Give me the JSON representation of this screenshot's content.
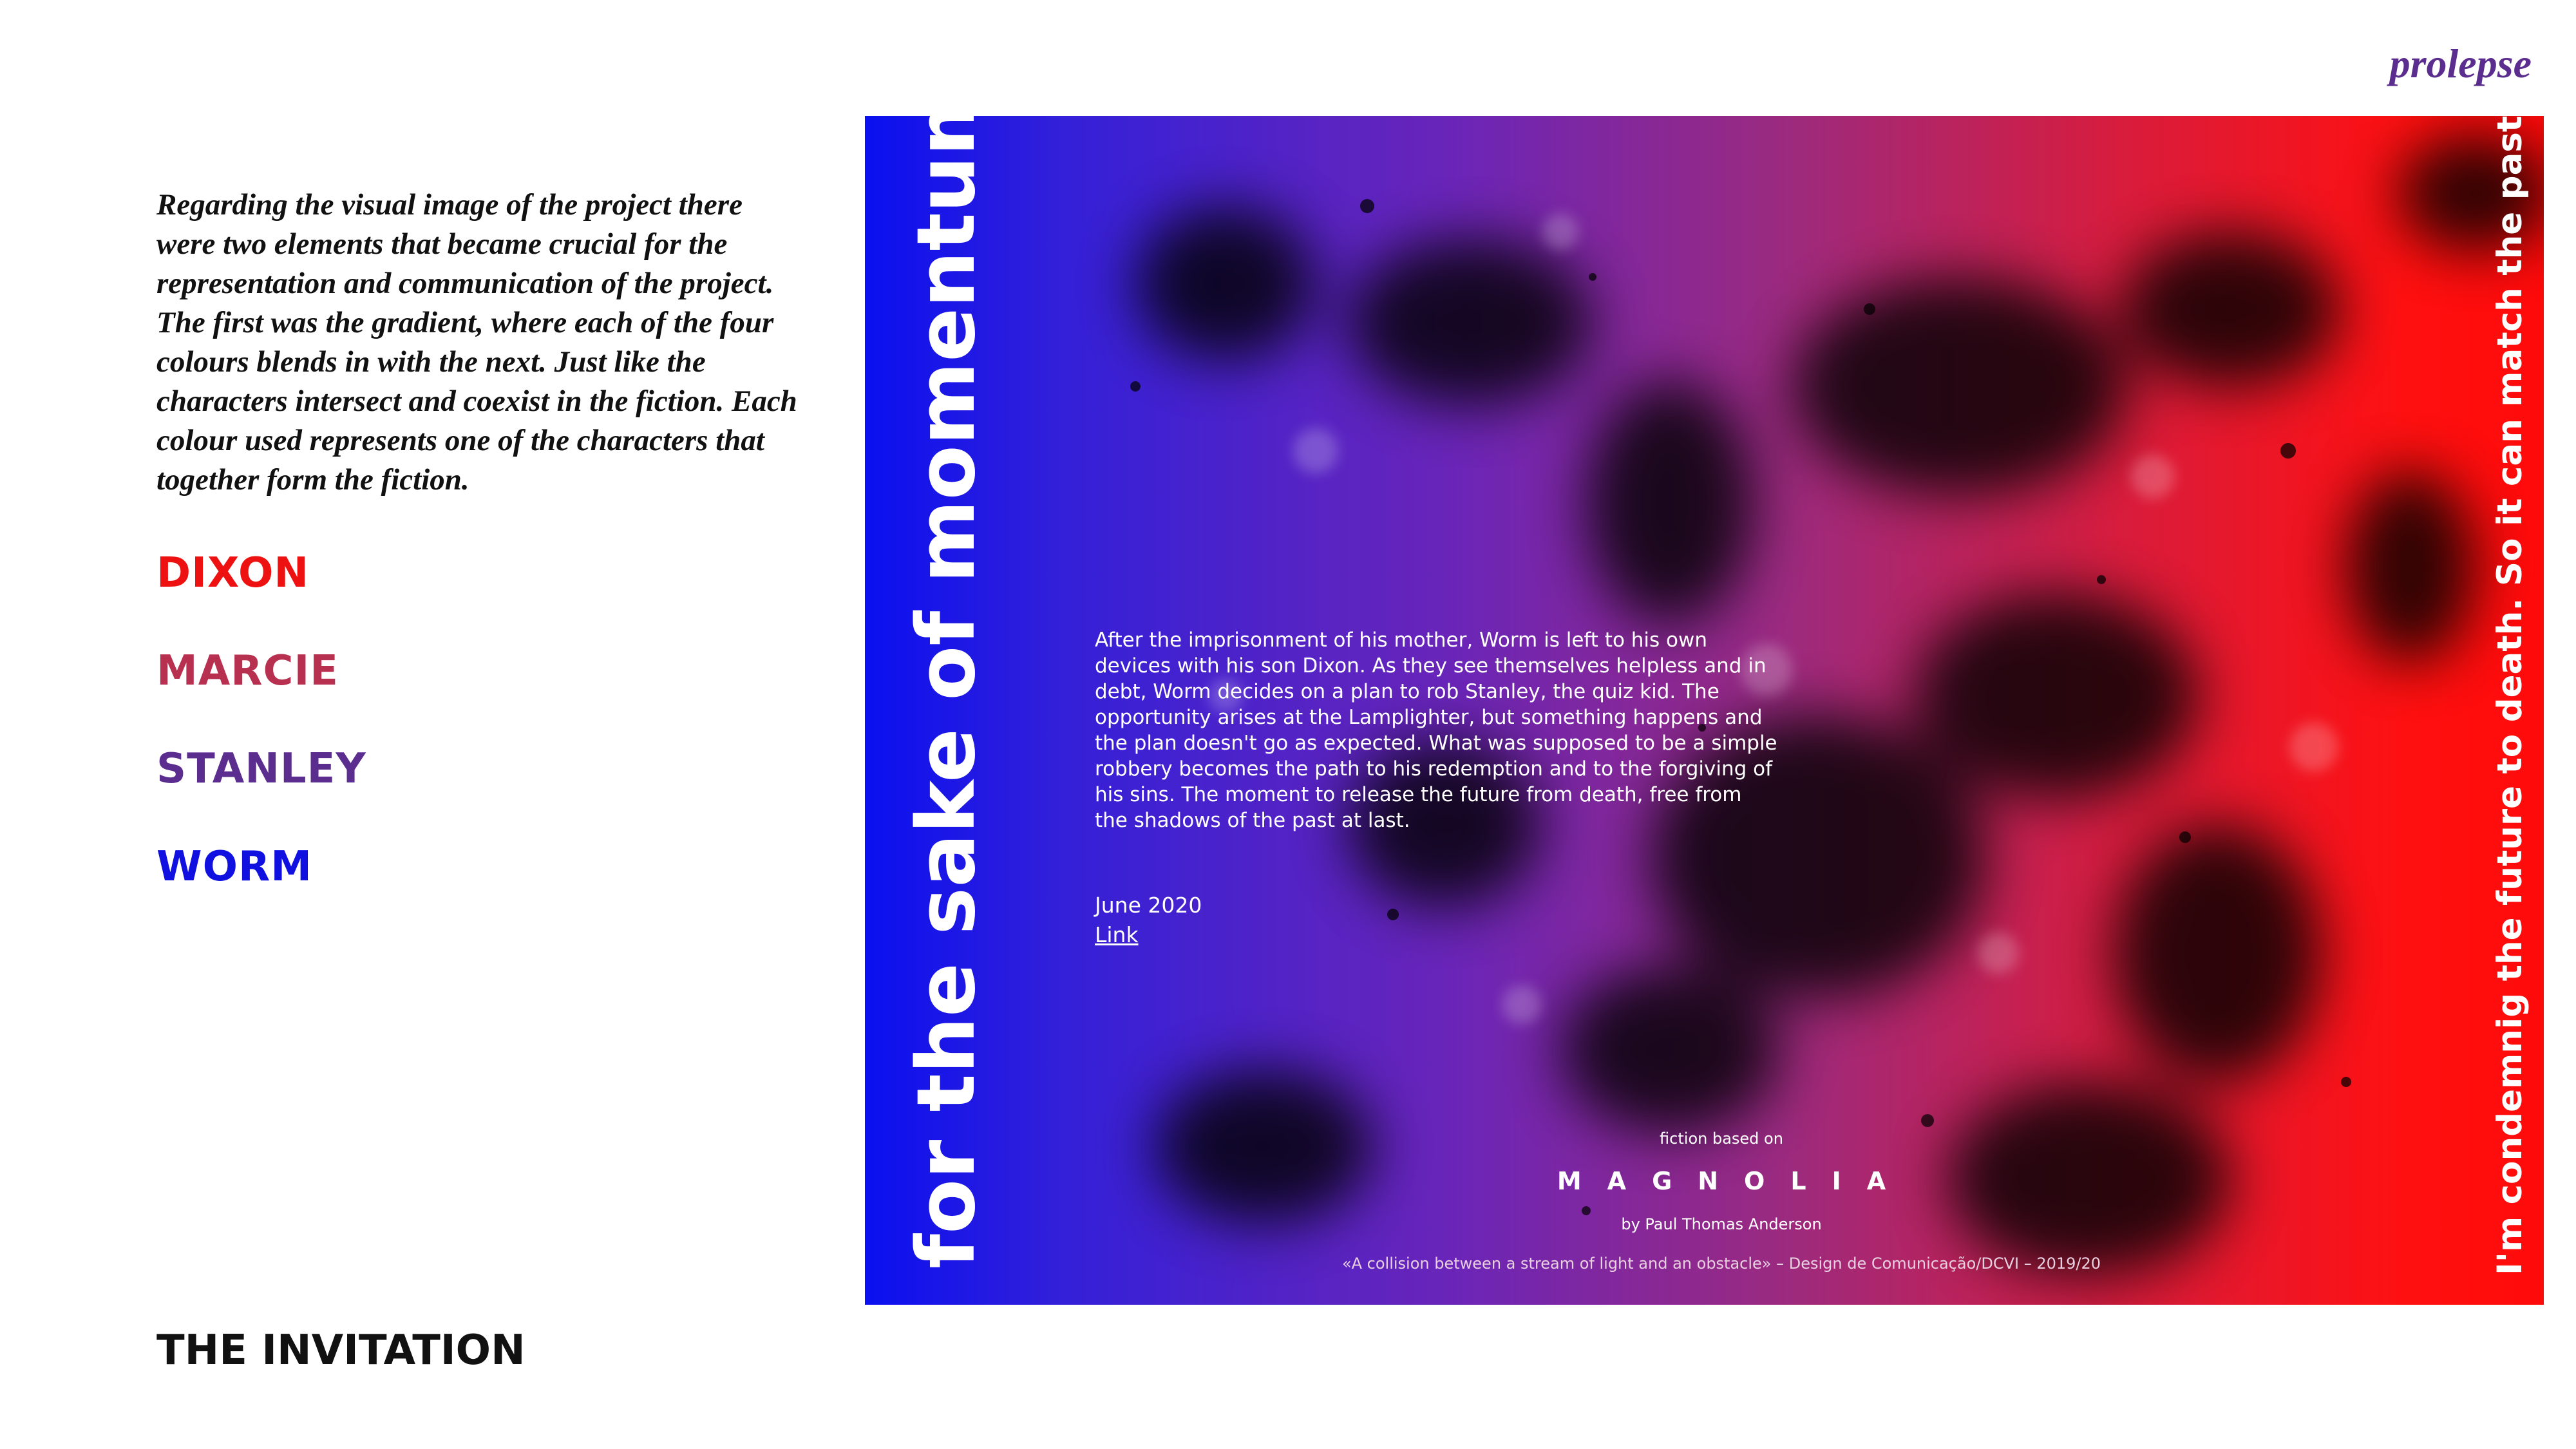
{
  "header": {
    "brand": "prolepse"
  },
  "intro": {
    "text": "Regarding the visual image of the project there were two elements that became crucial for the representation and communication of the project. The first was the gradient, where each of the four colours blends in with the next. Just like the characters intersect and coexist in the fiction. Each colour used represents one of the characters that together form the fiction."
  },
  "characters": [
    {
      "name": "DIXON",
      "color": "#ee1111"
    },
    {
      "name": "MARCIE",
      "color": "#b83050"
    },
    {
      "name": "STANLEY",
      "color": "#5b2d8e"
    },
    {
      "name": "WORM",
      "color": "#1010e0"
    }
  ],
  "section": {
    "title": "THE INVITATION"
  },
  "poster": {
    "vertical_left": "for the sake of momentum",
    "vertical_right": "I'm condemnig the future to death. So it can match the past",
    "synopsis": "After the imprisonment of his mother, Worm is left to his own devices with his son Dixon. As they see themselves helpless and in debt, Worm decides on a plan to rob Stanley, the quiz kid. The opportunity arises at the Lamplighter, but something happens and the plan doesn't go as expected. What was supposed to be a simple robbery becomes the path to his redemption and to the forgiving of his sins. The moment to release the future from death, free from the shadows of the past at last.",
    "date": "June 2020",
    "link": "Link",
    "fiction_based": "fiction based on",
    "film_title": "MAGNOLIA",
    "author": "by Paul Thomas Anderson",
    "quote": "«A collision between a stream of light and an obstacle» – Design de Comunicação/DCVI – 2019/20",
    "gradient_colors": [
      "#0a10f0",
      "#6a25b8",
      "#9c2a7e",
      "#d81c3c",
      "#ff0a0a"
    ]
  }
}
